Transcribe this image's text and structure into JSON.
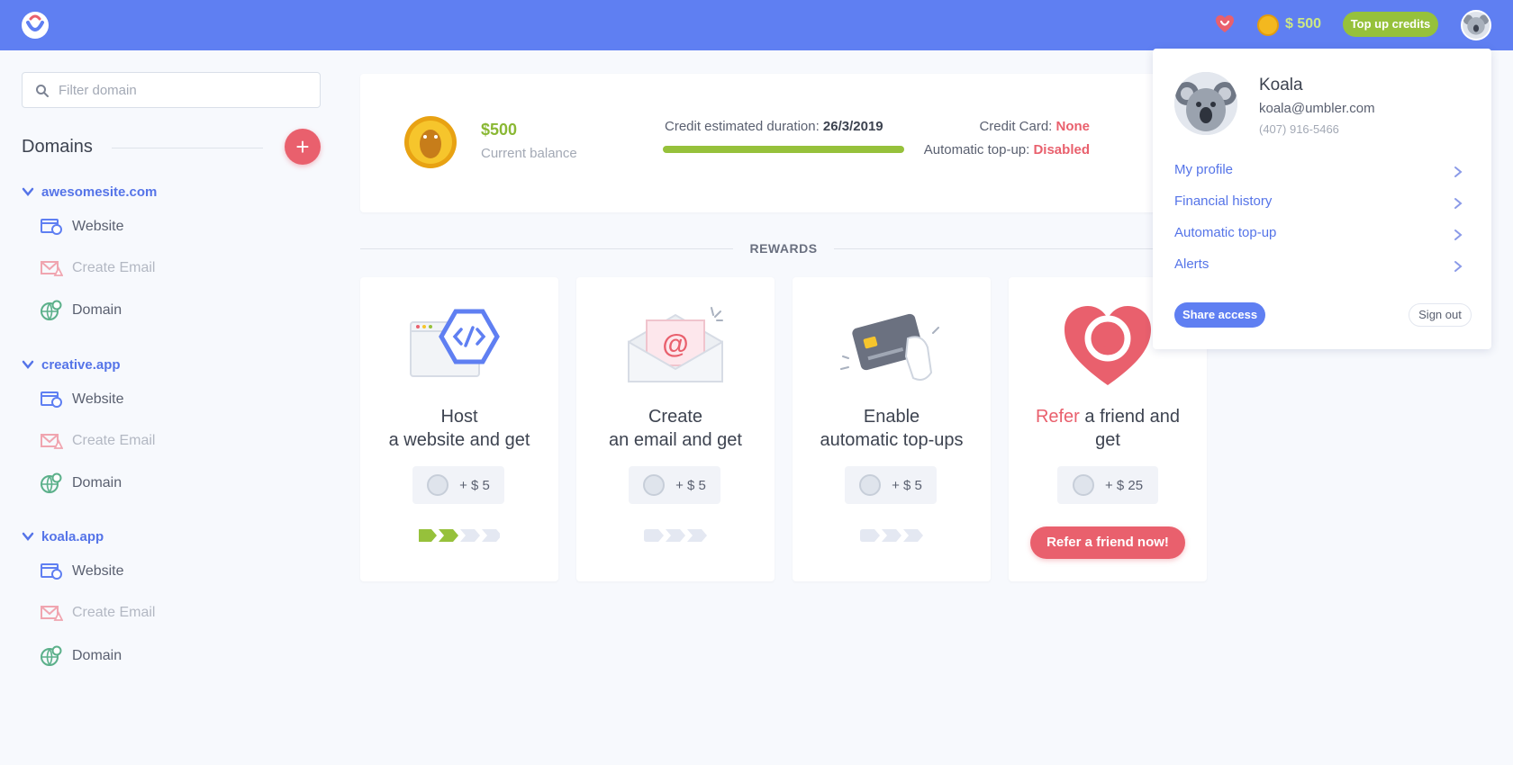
{
  "topbar": {
    "logo_icon": "umbler-smile-logo",
    "heart_icon": "heart-smile-icon",
    "coin_icon": "coin-icon",
    "balance": "$ 500",
    "topup_label": "Top up credits",
    "avatar_icon": "koala-avatar-icon"
  },
  "sidebar": {
    "filter_placeholder": "Filter domain",
    "domains_title": "Domains",
    "add_label": "+",
    "domains": [
      {
        "name": "awesomesite.com",
        "items": [
          "Website",
          "Create Email",
          "Domain"
        ]
      },
      {
        "name": "creative.app",
        "items": [
          "Website",
          "Create Email",
          "Domain"
        ]
      },
      {
        "name": "koala.app",
        "items": [
          "Website",
          "Create Email",
          "Domain"
        ]
      }
    ]
  },
  "summary": {
    "balance_value": "$500",
    "balance_label": "Current balance",
    "duration_label": "Credit estimated duration: ",
    "duration_value": "26/3/2019",
    "duration_progress": 1.0,
    "credit_card_label": "Credit Card: ",
    "credit_card_value": "None",
    "auto_topup_label": "Automatic top-up: ",
    "auto_topup_value": "Disabled"
  },
  "rewards": {
    "title": "REWARDS",
    "cards": [
      {
        "title_line1": "Host",
        "title_line2": "a website and get",
        "reward": "+ $ 5",
        "progress_steps_done": 2,
        "progress_steps_total": 4
      },
      {
        "title_line1": "Create",
        "title_line2": "an email and get",
        "reward": "+ $ 5",
        "progress_steps_done": 0,
        "progress_steps_total": 3
      },
      {
        "title_line1": "Enable",
        "title_line2": "automatic top-ups",
        "reward": "+ $ 5",
        "progress_steps_done": 0,
        "progress_steps_total": 3
      },
      {
        "title_accent": "Refer",
        "title_line1_rest": " a friend and",
        "title_line2": "get",
        "reward": "+ $ 25",
        "button": "Refer a friend now!"
      }
    ]
  },
  "profile_menu": {
    "name": "Koala",
    "email": "koala@umbler.com",
    "phone": "(407) 916-5466",
    "items": [
      "My profile",
      "Financial history",
      "Automatic top-up",
      "Alerts"
    ],
    "share_label": "Share access",
    "signout_label": "Sign out"
  },
  "colors": {
    "topbar": "#5f7ff2",
    "accent_green": "#96c13b",
    "accent_red": "#e9606d",
    "link_blue": "#5574e8"
  }
}
